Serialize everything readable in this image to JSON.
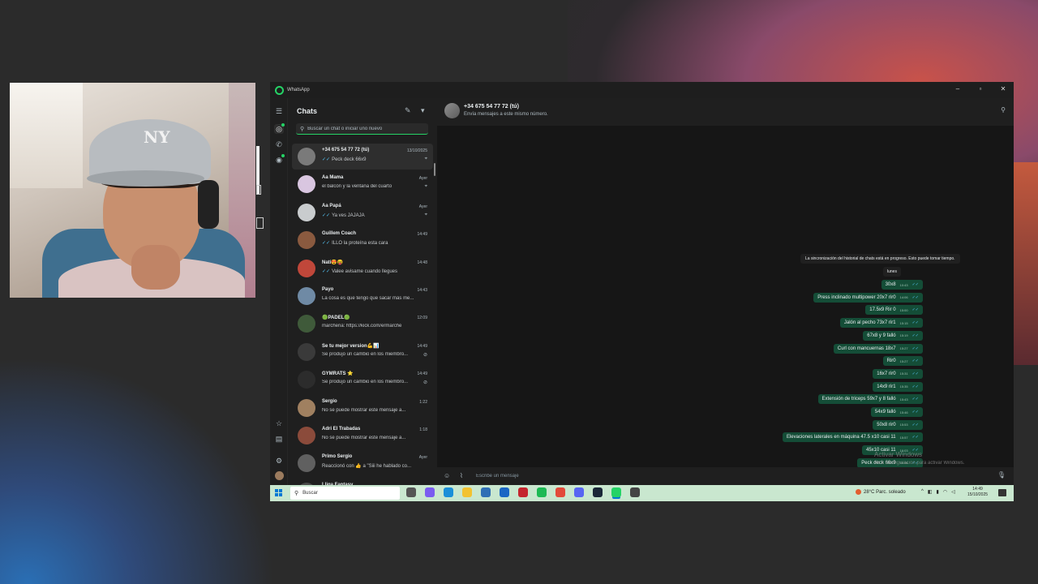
{
  "window": {
    "title": "WhatsApp",
    "controls": {
      "minimize": "–",
      "maximize": "▫",
      "close": "✕"
    }
  },
  "chatlist": {
    "title": "Chats",
    "search_placeholder": "Buscar un chat o iniciar uno nuevo",
    "chats": [
      {
        "name": "+34 675 54 77 72 (tú)",
        "time": "13/10/2025",
        "preview": "Peck deck 66x9",
        "tick": "✓✓",
        "icon": "pin-icon",
        "avatar_color": "#7a7a7a",
        "selected": true
      },
      {
        "name": "Aa Mama",
        "time": "Ayer",
        "preview": "el balcón y la ventana del cuarto",
        "tick": "",
        "icon": "pin-icon",
        "avatar_color": "#d9c6e0",
        "selected": false
      },
      {
        "name": "Aa Papá",
        "time": "Ayer",
        "preview": "Ya ves JAJAJA",
        "tick": "✓✓",
        "icon": "pin-icon",
        "avatar_color": "#c9ccce",
        "selected": false
      },
      {
        "name": "Guillem Coach",
        "time": "14:49",
        "preview": "ILLO la proteína esta cara",
        "tick": "✓✓",
        "icon": "",
        "avatar_color": "#8a5a3f",
        "selected": false
      },
      {
        "name": "Nati😍😝",
        "time": "14:48",
        "preview": "Valee avisame cuando llegues",
        "tick": "✓✓",
        "icon": "",
        "avatar_color": "#c0473a",
        "selected": false
      },
      {
        "name": "Payo",
        "time": "14:43",
        "preview": "La cosa es que tengo que sacar más me...",
        "tick": "",
        "icon": "",
        "avatar_color": "#6f8aa5",
        "selected": false
      },
      {
        "name": "🟢PADEL🟢",
        "time": "12:09",
        "preview": "marchena: https://kick.com/ermarche",
        "tick": "",
        "icon": "",
        "avatar_color": "#3f5a3a",
        "selected": false
      },
      {
        "name": "Se tu mejor version💪📊",
        "time": "14:49",
        "preview": "Se produjo un cambio en los miembro...",
        "tick": "",
        "icon": "muted-icon",
        "avatar_color": "#3a3a3a",
        "selected": false
      },
      {
        "name": "GYMRATS ⭐",
        "time": "14:49",
        "preview": "Se produjo un cambio en los miembro...",
        "tick": "",
        "icon": "muted-icon",
        "avatar_color": "#2c2c2c",
        "selected": false
      },
      {
        "name": "Sergio",
        "time": "1:22",
        "preview": "No se puede mostrar este mensaje a...",
        "tick": "",
        "icon": "",
        "avatar_color": "#a08060",
        "selected": false
      },
      {
        "name": "Adri El Trabadas",
        "time": "1:18",
        "preview": "No se puede mostrar este mensaje a...",
        "tick": "",
        "icon": "",
        "avatar_color": "#8b4b3b",
        "selected": false
      },
      {
        "name": "Primo Sergio",
        "time": "Ayer",
        "preview": "Reaccionó con 👍 a \"Siii he hablado co...",
        "tick": "",
        "icon": "",
        "avatar_color": "#606060",
        "selected": false
      },
      {
        "name": "Lliga Fantasy",
        "time": "",
        "preview": "",
        "tick": "",
        "icon": "",
        "avatar_color": "#4a4a4a",
        "selected": false
      }
    ]
  },
  "conversation": {
    "contact_name": "+34 675 54 77 72 (tú)",
    "contact_sub": "Envía mensajes a este mismo número.",
    "system_message": "La sincronización del historial de chats está en progreso. Esto puede tomar tiempo.",
    "day_label": "lunes",
    "messages": [
      {
        "text": "30x8",
        "time": "10:43"
      },
      {
        "text": "Press inclinado multipower 20x7 rir0",
        "time": "14:06"
      },
      {
        "text": "17.5x9 Rir 0",
        "time": "15:00"
      },
      {
        "text": "Jalón al pecho 73x7 rir1",
        "time": "15:15"
      },
      {
        "text": "67x8 y 9 falló",
        "time": "15:19"
      },
      {
        "text": "Curl con mancuernas 18x7",
        "time": "15:27"
      },
      {
        "text": "Rir0",
        "time": "15:27"
      },
      {
        "text": "16x7 rir0",
        "time": "15:31"
      },
      {
        "text": "14x9 rir1",
        "time": "15:35"
      },
      {
        "text": "Extensión de triceps 59x7 y 8 falló",
        "time": "15:43"
      },
      {
        "text": "54x9 falló",
        "time": "15:46"
      },
      {
        "text": "50x8 rir0",
        "time": "15:53"
      },
      {
        "text": "Elevaciones laterales en máquina 47.5 x10 casi 11",
        "time": "15:57"
      },
      {
        "text": "45x10 casi 11",
        "time": "16:03"
      },
      {
        "text": "Peck deck 66x9",
        "time": "16:06"
      }
    ],
    "composer_placeholder": "Escribe un mensaje"
  },
  "watermark": {
    "line1": "Activar Windows",
    "line2": "Ve a Configuración para activar Windows."
  },
  "taskbar": {
    "search_label": "Buscar",
    "weather": "28°C  Parc. soleado",
    "time": "14:49",
    "date": "15/10/2025",
    "apps": [
      {
        "name": "task-view-icon",
        "color": "#555"
      },
      {
        "name": "copilot-icon",
        "color": "#7a5cf0"
      },
      {
        "name": "edge-icon",
        "color": "#1b8fd8"
      },
      {
        "name": "file-explorer-icon",
        "color": "#f2c230"
      },
      {
        "name": "store-icon",
        "color": "#2f6fb5"
      },
      {
        "name": "outlook-icon",
        "color": "#1a66c4"
      },
      {
        "name": "app-red-icon",
        "color": "#c4262e"
      },
      {
        "name": "spotify-icon",
        "color": "#1db954"
      },
      {
        "name": "chrome-icon",
        "color": "#e24a3a"
      },
      {
        "name": "discord-icon",
        "color": "#5865f2"
      },
      {
        "name": "steam-icon",
        "color": "#1b2838"
      },
      {
        "name": "whatsapp-icon",
        "color": "#25d366"
      },
      {
        "name": "task-app-icon",
        "color": "#444"
      }
    ]
  },
  "colors": {
    "accent": "#25d366",
    "bubble_out": "#144d37",
    "app_bg": "#1f1f1f",
    "taskbar_bg": "#c9e7cf"
  }
}
